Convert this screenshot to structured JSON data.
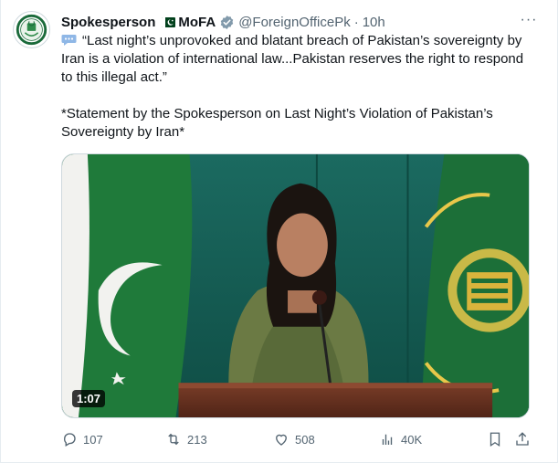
{
  "tweet": {
    "author_name": "Spokesperson",
    "author_name_2": "MoFA",
    "handle": "@ForeignOfficePk",
    "separator": "·",
    "time": "10h",
    "more_label": "···",
    "quote_text": "“Last night’s unprovoked and blatant breach of Pakistan’s sovereignty by Iran is a violation of international law...Pakistan reserves the right to respond to this illegal act.”",
    "statement_text": "*Statement by the Spokesperson on Last Night’s Violation of Pakistan’s Sovereignty by Iran*"
  },
  "media": {
    "duration": "1:07"
  },
  "actions": {
    "replies": "107",
    "reposts": "213",
    "likes": "508",
    "views": "40K"
  },
  "colors": {
    "text_primary": "#0f1419",
    "text_secondary": "#536471",
    "verified_gray": "#829aab",
    "flag_green": "#01411c"
  },
  "icons": [
    "reply-icon",
    "repost-icon",
    "like-icon",
    "views-icon",
    "bookmark-icon",
    "share-icon",
    "more-icon",
    "verified-badge-icon",
    "speech-bubble-icon",
    "pakistan-flag-icon"
  ]
}
